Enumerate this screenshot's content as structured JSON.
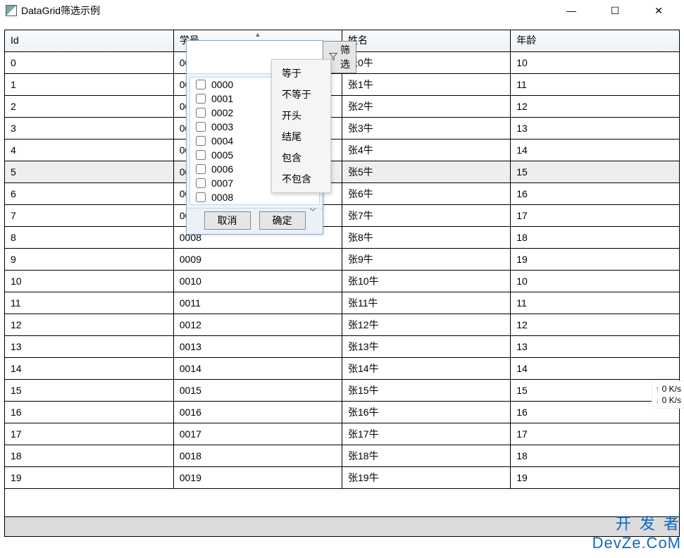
{
  "window": {
    "title": "DataGrid筛选示例",
    "minimize": "—",
    "maximize": "☐",
    "close": "✕"
  },
  "grid": {
    "columns": [
      "Id",
      "学号",
      "姓名",
      "年龄"
    ],
    "sort_column_index": 1,
    "rows": [
      {
        "id": "0",
        "sno": "0000",
        "name": "张0牛",
        "age": "10"
      },
      {
        "id": "1",
        "sno": "0001",
        "name": "张1牛",
        "age": "11"
      },
      {
        "id": "2",
        "sno": "0002",
        "name": "张2牛",
        "age": "12"
      },
      {
        "id": "3",
        "sno": "0003",
        "name": "张3牛",
        "age": "13"
      },
      {
        "id": "4",
        "sno": "0004",
        "name": "张4牛",
        "age": "14"
      },
      {
        "id": "5",
        "sno": "0005",
        "name": "张5牛",
        "age": "15",
        "selected": true
      },
      {
        "id": "6",
        "sno": "0006",
        "name": "张6牛",
        "age": "16"
      },
      {
        "id": "7",
        "sno": "0007",
        "name": "张7牛",
        "age": "17"
      },
      {
        "id": "8",
        "sno": "0008",
        "name": "张8牛",
        "age": "18"
      },
      {
        "id": "9",
        "sno": "0009",
        "name": "张9牛",
        "age": "19"
      },
      {
        "id": "10",
        "sno": "0010",
        "name": "张10牛",
        "age": "10"
      },
      {
        "id": "11",
        "sno": "0011",
        "name": "张11牛",
        "age": "11"
      },
      {
        "id": "12",
        "sno": "0012",
        "name": "张12牛",
        "age": "12"
      },
      {
        "id": "13",
        "sno": "0013",
        "name": "张13牛",
        "age": "13"
      },
      {
        "id": "14",
        "sno": "0014",
        "name": "张14牛",
        "age": "14"
      },
      {
        "id": "15",
        "sno": "0015",
        "name": "张15牛",
        "age": "15"
      },
      {
        "id": "16",
        "sno": "0016",
        "name": "张16牛",
        "age": "16"
      },
      {
        "id": "17",
        "sno": "0017",
        "name": "张17牛",
        "age": "17"
      },
      {
        "id": "18",
        "sno": "0018",
        "name": "张18牛",
        "age": "18"
      },
      {
        "id": "19",
        "sno": "0019",
        "name": "张19牛",
        "age": "19"
      }
    ]
  },
  "filter_popup": {
    "search_placeholder": "",
    "filter_button": "筛选",
    "values": [
      "0000",
      "0001",
      "0002",
      "0003",
      "0004",
      "0005",
      "0006",
      "0007",
      "0008"
    ],
    "cancel": "取消",
    "ok": "确定"
  },
  "filter_type_menu": {
    "items": [
      "等于",
      "不等于",
      "开头",
      "结尾",
      "包含",
      "不包含"
    ]
  },
  "watermark": {
    "cn": "开 发 者",
    "en": "DevZe.CoM"
  },
  "netspeed": {
    "up": "0  K/s",
    "down": "0  K/s"
  }
}
